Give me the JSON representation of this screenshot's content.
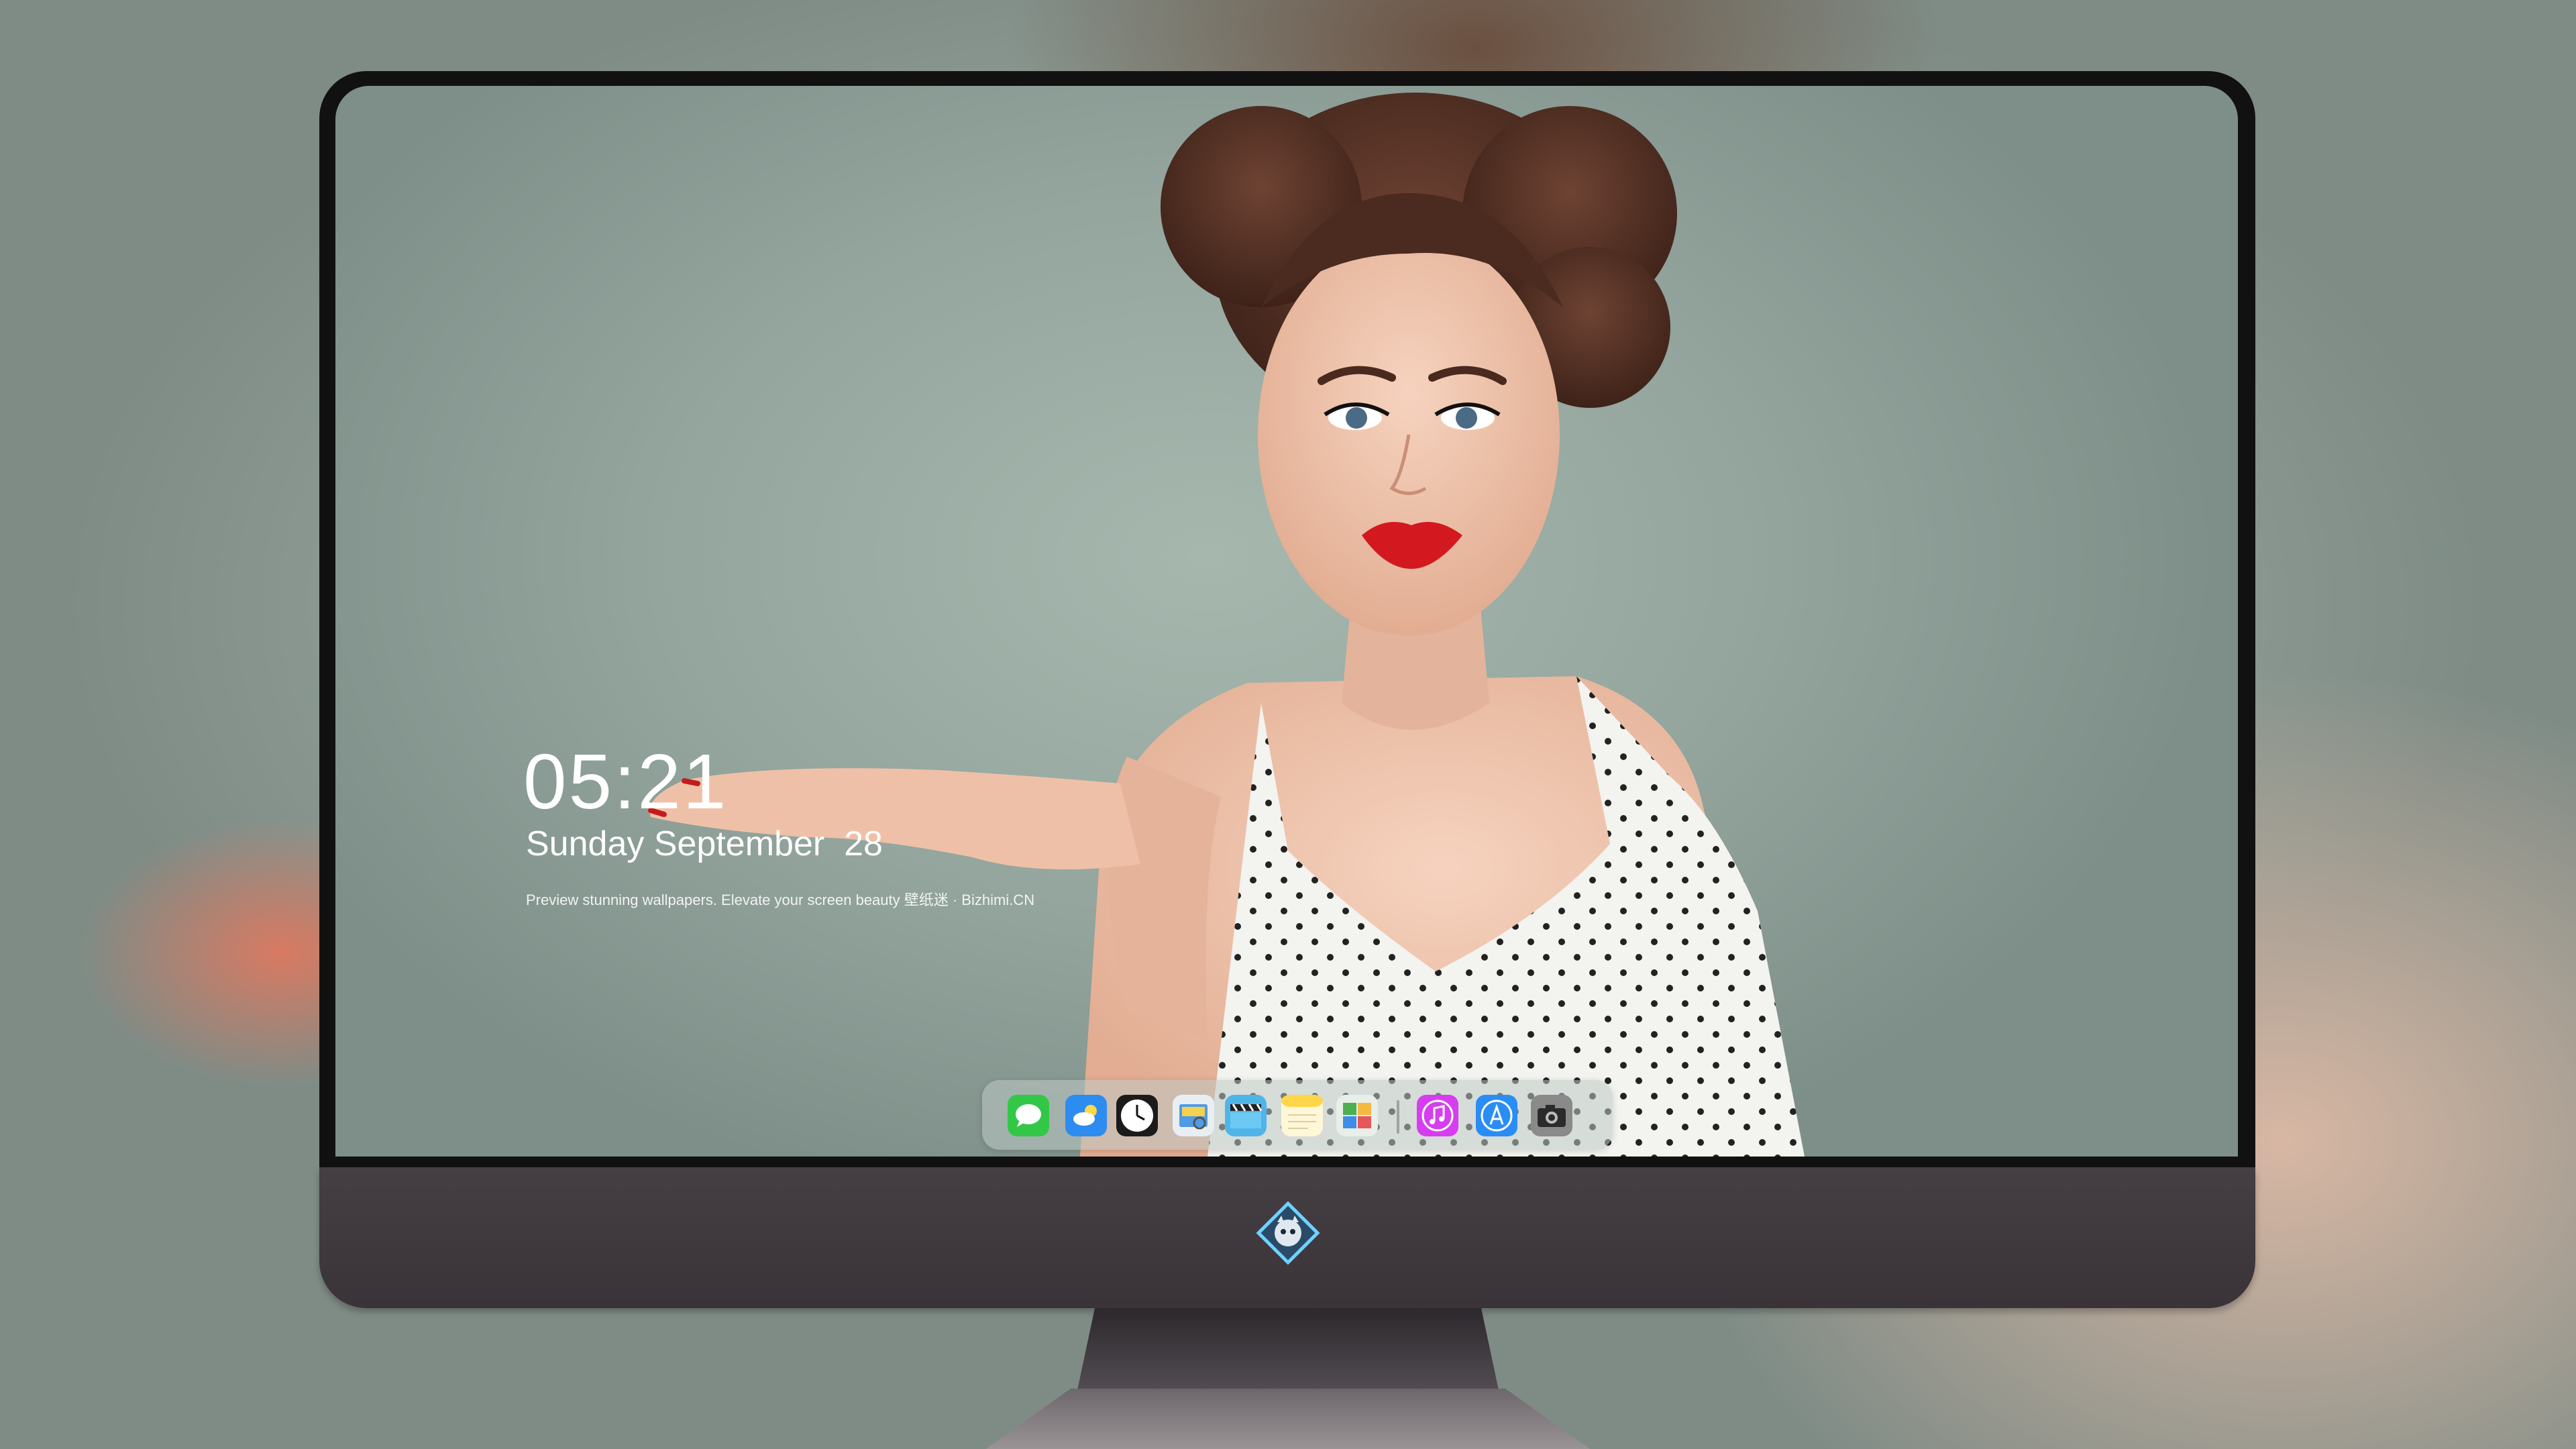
{
  "lockscreen": {
    "time": "05:21",
    "date": "Sunday September  28",
    "tagline": "Preview stunning wallpapers. Elevate your screen beauty  壁纸迷 · Bizhimi.CN"
  },
  "dock": {
    "apps": [
      {
        "name": "Messages",
        "icon": "messages-icon",
        "color": "#33c747"
      },
      {
        "name": "Weather",
        "icon": "weather-icon",
        "color": "#2d8cf0"
      },
      {
        "name": "Clock",
        "icon": "clock-icon",
        "color": "#1b1b1b"
      },
      {
        "name": "Preview",
        "icon": "preview-icon",
        "color": "#e9eef3"
      },
      {
        "name": "Video",
        "icon": "clapperboard-icon",
        "color": "#4fb4e8"
      },
      {
        "name": "Notes",
        "icon": "notes-icon",
        "color": "#ffd54a"
      },
      {
        "name": "Photos",
        "icon": "photos-icon",
        "color": "#e8efe9"
      },
      {
        "name": "Music",
        "icon": "music-icon",
        "color": "#d63df0"
      },
      {
        "name": "App Store",
        "icon": "app-store-icon",
        "color": "#2a8df5"
      },
      {
        "name": "Camera",
        "icon": "camera-icon",
        "color": "#8a8a8a"
      }
    ]
  },
  "theme": {
    "screen_bg": "#9aaca3",
    "bezel": "#111111",
    "chin": "#3f383d",
    "lip_red": "#d3191f"
  }
}
